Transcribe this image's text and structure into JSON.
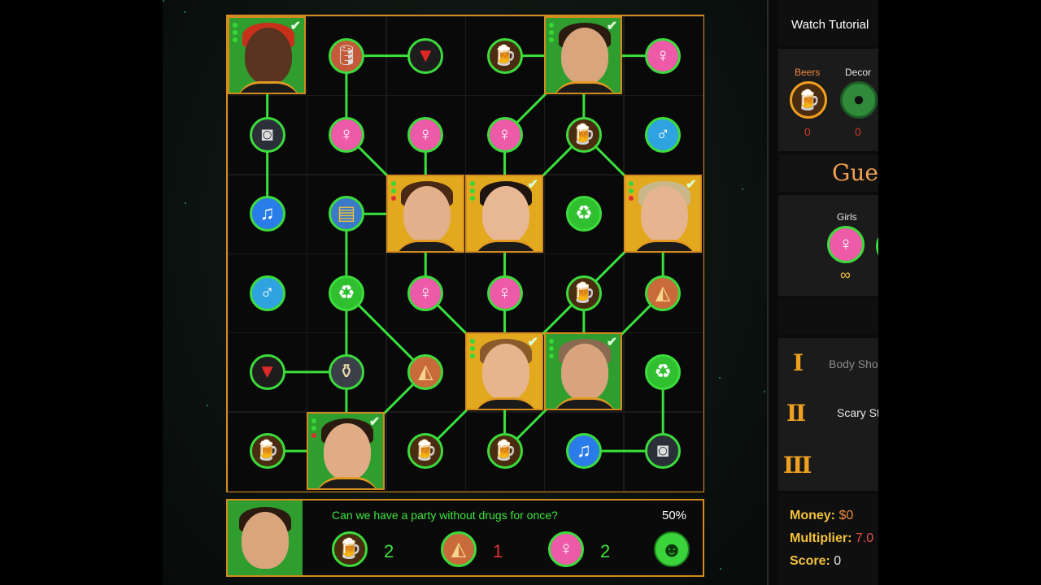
{
  "board": {
    "rows": 6,
    "cols": 6,
    "cells": [
      {
        "r": 0,
        "c": 0,
        "kind": "guest",
        "bg": "green",
        "skin": "#5a3420",
        "hair": "#c8301c",
        "checked": true,
        "dots": [
          "g",
          "g",
          "g"
        ]
      },
      {
        "r": 0,
        "c": 1,
        "kind": "token",
        "type": "keg",
        "icon": "keg-icon",
        "glyph": "🛢"
      },
      {
        "r": 0,
        "c": 2,
        "kind": "token",
        "type": "cup",
        "icon": "red-cup-icon",
        "glyph": "▼"
      },
      {
        "r": 0,
        "c": 3,
        "kind": "token",
        "type": "beer",
        "icon": "beer-icon",
        "glyph": "🍺"
      },
      {
        "r": 0,
        "c": 4,
        "kind": "guest",
        "bg": "green",
        "skin": "#d9a57c",
        "hair": "#2a1a10",
        "checked": true,
        "dots": [
          "g",
          "g",
          "g"
        ]
      },
      {
        "r": 0,
        "c": 5,
        "kind": "token",
        "type": "female",
        "icon": "female-icon",
        "glyph": "♀"
      },
      {
        "r": 1,
        "c": 0,
        "kind": "token",
        "type": "speaker",
        "icon": "speaker-icon",
        "glyph": "◙"
      },
      {
        "r": 1,
        "c": 1,
        "kind": "token",
        "type": "female",
        "icon": "female-icon",
        "glyph": "♀"
      },
      {
        "r": 1,
        "c": 2,
        "kind": "token",
        "type": "female",
        "icon": "female-icon",
        "glyph": "♀"
      },
      {
        "r": 1,
        "c": 3,
        "kind": "token",
        "type": "female",
        "icon": "female-icon",
        "glyph": "♀"
      },
      {
        "r": 1,
        "c": 4,
        "kind": "token",
        "type": "beer",
        "icon": "beer-icon",
        "glyph": "🍺"
      },
      {
        "r": 1,
        "c": 5,
        "kind": "token",
        "type": "male",
        "icon": "male-icon",
        "glyph": "♂"
      },
      {
        "r": 2,
        "c": 0,
        "kind": "token",
        "type": "music",
        "icon": "music-note-icon",
        "glyph": "♫"
      },
      {
        "r": 2,
        "c": 1,
        "kind": "token",
        "type": "cereal",
        "icon": "cereal-box-icon",
        "glyph": "▤"
      },
      {
        "r": 2,
        "c": 2,
        "kind": "guest",
        "bg": "yellow",
        "skin": "#e2b08a",
        "hair": "#4a2a15",
        "checked": false,
        "dots": [
          "g",
          "g",
          "r"
        ]
      },
      {
        "r": 2,
        "c": 3,
        "kind": "guest",
        "bg": "yellow",
        "skin": "#e8b894",
        "hair": "#1e1410",
        "checked": true,
        "dots": [
          "g",
          "g",
          "g"
        ]
      },
      {
        "r": 2,
        "c": 4,
        "kind": "token",
        "type": "recycle",
        "icon": "recycle-icon",
        "glyph": "♻"
      },
      {
        "r": 2,
        "c": 5,
        "kind": "guest",
        "bg": "yellow",
        "skin": "#e6b48e",
        "hair": "#c9b78a",
        "checked": true,
        "dots": [
          "g",
          "g",
          "r"
        ]
      },
      {
        "r": 3,
        "c": 0,
        "kind": "token",
        "type": "male",
        "icon": "male-icon",
        "glyph": "♂"
      },
      {
        "r": 3,
        "c": 1,
        "kind": "token",
        "type": "recycle",
        "icon": "recycle-icon",
        "glyph": "♻"
      },
      {
        "r": 3,
        "c": 2,
        "kind": "token",
        "type": "female",
        "icon": "female-icon",
        "glyph": "♀"
      },
      {
        "r": 3,
        "c": 3,
        "kind": "token",
        "type": "female",
        "icon": "female-icon",
        "glyph": "♀"
      },
      {
        "r": 3,
        "c": 4,
        "kind": "token",
        "type": "beer",
        "icon": "beer-icon",
        "glyph": "🍺"
      },
      {
        "r": 3,
        "c": 5,
        "kind": "token",
        "type": "pizza",
        "icon": "pizza-icon",
        "glyph": "◭"
      },
      {
        "r": 4,
        "c": 0,
        "kind": "token",
        "type": "cup",
        "icon": "red-cup-icon",
        "glyph": "▼"
      },
      {
        "r": 4,
        "c": 1,
        "kind": "token",
        "type": "bottles",
        "icon": "liquor-bottles-icon",
        "glyph": "⚱"
      },
      {
        "r": 4,
        "c": 2,
        "kind": "token",
        "type": "pizza",
        "icon": "pizza-icon",
        "glyph": "◭"
      },
      {
        "r": 4,
        "c": 3,
        "kind": "guest",
        "bg": "yellow",
        "skin": "#e7b58d",
        "hair": "#8a5a2a",
        "checked": true,
        "dots": [
          "g",
          "g",
          "g"
        ]
      },
      {
        "r": 4,
        "c": 4,
        "kind": "guest",
        "bg": "green",
        "skin": "#d8a37d",
        "hair": "#8a6a50",
        "checked": true,
        "dots": [
          "g",
          "g",
          "g"
        ]
      },
      {
        "r": 4,
        "c": 5,
        "kind": "token",
        "type": "recycle",
        "icon": "recycle-icon",
        "glyph": "♻"
      },
      {
        "r": 5,
        "c": 0,
        "kind": "token",
        "type": "beer",
        "icon": "beer-icon",
        "glyph": "🍺"
      },
      {
        "r": 5,
        "c": 1,
        "kind": "guest",
        "bg": "green",
        "skin": "#e0ac86",
        "hair": "#2a1a10",
        "checked": true,
        "dots": [
          "g",
          "g",
          "r"
        ]
      },
      {
        "r": 5,
        "c": 2,
        "kind": "token",
        "type": "beer",
        "icon": "beer-icon",
        "glyph": "🍺"
      },
      {
        "r": 5,
        "c": 3,
        "kind": "token",
        "type": "beer",
        "icon": "beer-icon",
        "glyph": "🍺"
      },
      {
        "r": 5,
        "c": 4,
        "kind": "token",
        "type": "music",
        "icon": "music-note-icon",
        "glyph": "♫"
      },
      {
        "r": 5,
        "c": 5,
        "kind": "token",
        "type": "speaker",
        "icon": "speaker-icon",
        "glyph": "◙"
      }
    ],
    "links": [
      [
        0,
        0,
        1,
        0
      ],
      [
        0,
        1,
        0,
        2
      ],
      [
        0,
        3,
        0,
        4
      ],
      [
        0,
        4,
        0,
        5
      ],
      [
        1,
        0,
        2,
        0
      ],
      [
        0,
        1,
        1,
        1
      ],
      [
        1,
        1,
        2,
        2
      ],
      [
        1,
        2,
        2,
        2
      ],
      [
        1,
        3,
        2,
        3
      ],
      [
        1,
        4,
        2,
        3
      ],
      [
        1,
        4,
        2,
        5
      ],
      [
        0,
        4,
        1,
        4
      ],
      [
        0,
        4,
        1,
        3
      ],
      [
        2,
        1,
        2,
        2
      ],
      [
        2,
        1,
        3,
        1
      ],
      [
        2,
        2,
        3,
        2
      ],
      [
        2,
        3,
        3,
        3
      ],
      [
        3,
        1,
        4,
        2
      ],
      [
        3,
        2,
        4,
        3
      ],
      [
        3,
        3,
        4,
        3
      ],
      [
        3,
        4,
        4,
        4
      ],
      [
        3,
        4,
        2,
        5
      ],
      [
        3,
        5,
        2,
        5
      ],
      [
        3,
        5,
        4,
        4
      ],
      [
        3,
        1,
        4,
        1
      ],
      [
        3,
        4,
        4,
        3
      ],
      [
        4,
        0,
        4,
        1
      ],
      [
        4,
        1,
        5,
        1
      ],
      [
        4,
        2,
        5,
        1
      ],
      [
        4,
        3,
        5,
        3
      ],
      [
        4,
        3,
        5,
        2
      ],
      [
        4,
        4,
        5,
        3
      ],
      [
        4,
        5,
        5,
        5
      ],
      [
        5,
        4,
        5,
        5
      ],
      [
        5,
        0,
        5,
        1
      ]
    ]
  },
  "request": {
    "quote": "Can we have a party without drugs for once?",
    "percent": "50%",
    "needs": [
      {
        "icon": "beer-icon",
        "type": "beer",
        "glyph": "🍺",
        "count": "2",
        "color": "#3ee43e"
      },
      {
        "icon": "pizza-icon",
        "type": "pizza",
        "glyph": "◭",
        "count": "1",
        "color": "#e03030"
      },
      {
        "icon": "female-icon",
        "type": "female",
        "glyph": "♀",
        "count": "2",
        "color": "#3ee43e"
      }
    ],
    "mood_glyph": "☻"
  },
  "side": {
    "tutorial": "Watch Tutorial",
    "tabs": [
      {
        "label": "Beers",
        "count": "0",
        "color": "#f08a3b",
        "icon": "beer-icon"
      },
      {
        "label": "Decor",
        "count": "0",
        "color": "#e6e6e6",
        "icon": "balloons-icon"
      }
    ],
    "guests_title": "Gues",
    "girls_label": "Girls",
    "girls_count": "∞",
    "tiers": [
      {
        "numeral": "I",
        "label": "Body Sho",
        "color": "#8a8a8a"
      },
      {
        "numeral": "II",
        "label": "Scary St",
        "color": "#e6e6e6"
      },
      {
        "numeral": "III",
        "label": "",
        "color": "#e6e6e6"
      }
    ],
    "money_label": "Money:",
    "money_value": "$0",
    "multiplier_label": "Multiplier:",
    "multiplier_value": "7.0",
    "score_label": "Score:",
    "score_value": "0"
  },
  "colors": {
    "accent": "#d48a1f",
    "link": "#3ce03c",
    "female": "#ec5aa8",
    "male": "#2fa3e0"
  }
}
